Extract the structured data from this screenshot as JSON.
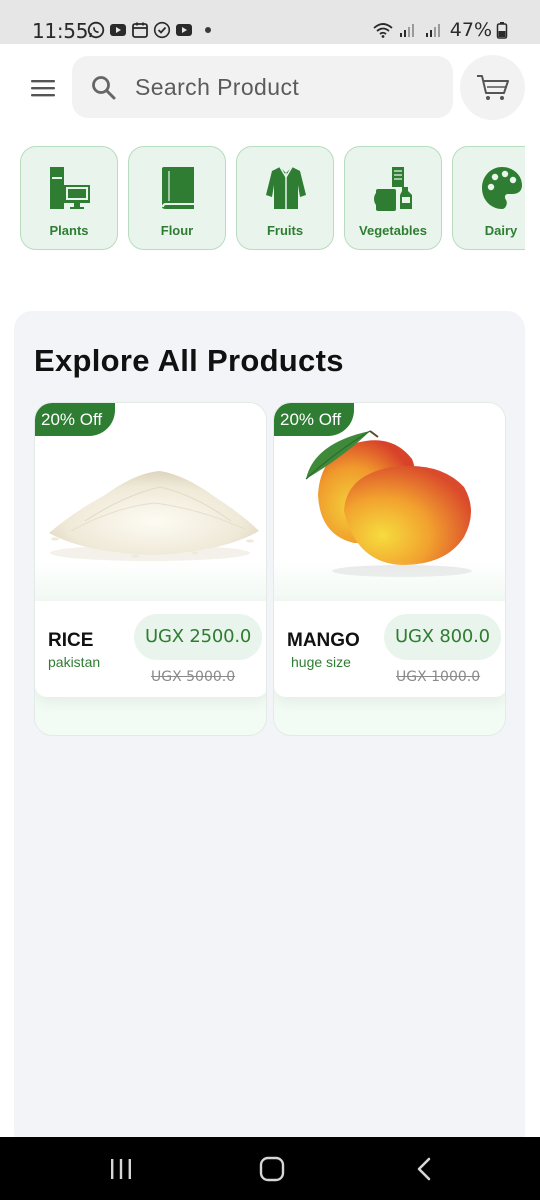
{
  "status_bar": {
    "time": "11:55",
    "battery": "47%",
    "app_icons": [
      "whatsapp-icon",
      "youtube-icon",
      "calendar-icon",
      "check-circle-icon",
      "youtube-icon"
    ]
  },
  "header": {
    "search_placeholder": "Search Product",
    "menu_icon": "hamburger-menu-icon",
    "cart_icon": "shopping-cart-icon"
  },
  "categories": [
    {
      "label": "Plants",
      "icon": "appliances-icon"
    },
    {
      "label": "Flour",
      "icon": "book-icon"
    },
    {
      "label": "Fruits",
      "icon": "shirt-icon"
    },
    {
      "label": "Vegetables",
      "icon": "groceries-icon"
    },
    {
      "label": "Dairy",
      "icon": "palette-icon"
    }
  ],
  "section": {
    "title": "Explore All Products"
  },
  "products": [
    {
      "badge": "20% Off",
      "name": "RICE",
      "subtitle": "pakistan",
      "price": "UGX 2500.0",
      "old_price": "UGX 5000.0",
      "image": "rice-image"
    },
    {
      "badge": "20% Off",
      "name": "MANGO",
      "subtitle": "huge size",
      "price": "UGX 800.0",
      "old_price": "UGX 1000.0",
      "image": "mango-image"
    }
  ],
  "colors": {
    "accent": "#2e7d32",
    "accent_light": "#e9f4ec",
    "panel_bg": "#f3f4f8"
  },
  "nav_bar": {
    "buttons": [
      "recent-apps-icon",
      "home-icon",
      "back-icon"
    ]
  }
}
